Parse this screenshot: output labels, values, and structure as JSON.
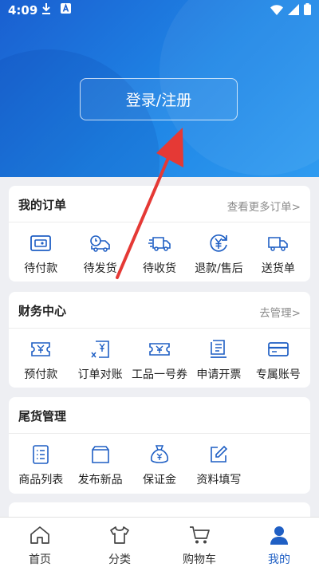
{
  "status": {
    "time": "4:09"
  },
  "header": {
    "login_label": "登录/注册"
  },
  "orders": {
    "title": "我的订单",
    "link": "查看更多订单>",
    "items": [
      {
        "label": "待付款",
        "icon": "wallet-icon"
      },
      {
        "label": "待发货",
        "icon": "delivery-truck-icon"
      },
      {
        "label": "待收货",
        "icon": "fast-truck-icon"
      },
      {
        "label": "退款/售后",
        "icon": "refund-icon"
      },
      {
        "label": "送货单",
        "icon": "truck-icon"
      }
    ]
  },
  "finance": {
    "title": "财务中心",
    "link": "去管理>",
    "items": [
      {
        "label": "预付款",
        "icon": "prepay-icon"
      },
      {
        "label": "订单对账",
        "icon": "reconcile-icon"
      },
      {
        "label": "工品一号券",
        "icon": "coupon-icon"
      },
      {
        "label": "申请开票",
        "icon": "invoice-icon"
      },
      {
        "label": "专属账号",
        "icon": "card-icon"
      }
    ]
  },
  "clearance": {
    "title": "尾货管理",
    "items": [
      {
        "label": "商品列表",
        "icon": "list-icon"
      },
      {
        "label": "发布新品",
        "icon": "new-product-icon"
      },
      {
        "label": "保证金",
        "icon": "money-bag-icon"
      },
      {
        "label": "资料填写",
        "icon": "edit-icon"
      }
    ]
  },
  "tabs": [
    {
      "label": "首页",
      "icon": "home-icon"
    },
    {
      "label": "分类",
      "icon": "category-icon"
    },
    {
      "label": "购物车",
      "icon": "cart-icon"
    },
    {
      "label": "我的",
      "icon": "user-icon"
    }
  ],
  "colors": {
    "brand": "#1f5fc4",
    "hero_start": "#1a5fd0",
    "hero_end": "#2f9bf0",
    "arrow": "#e53935"
  }
}
